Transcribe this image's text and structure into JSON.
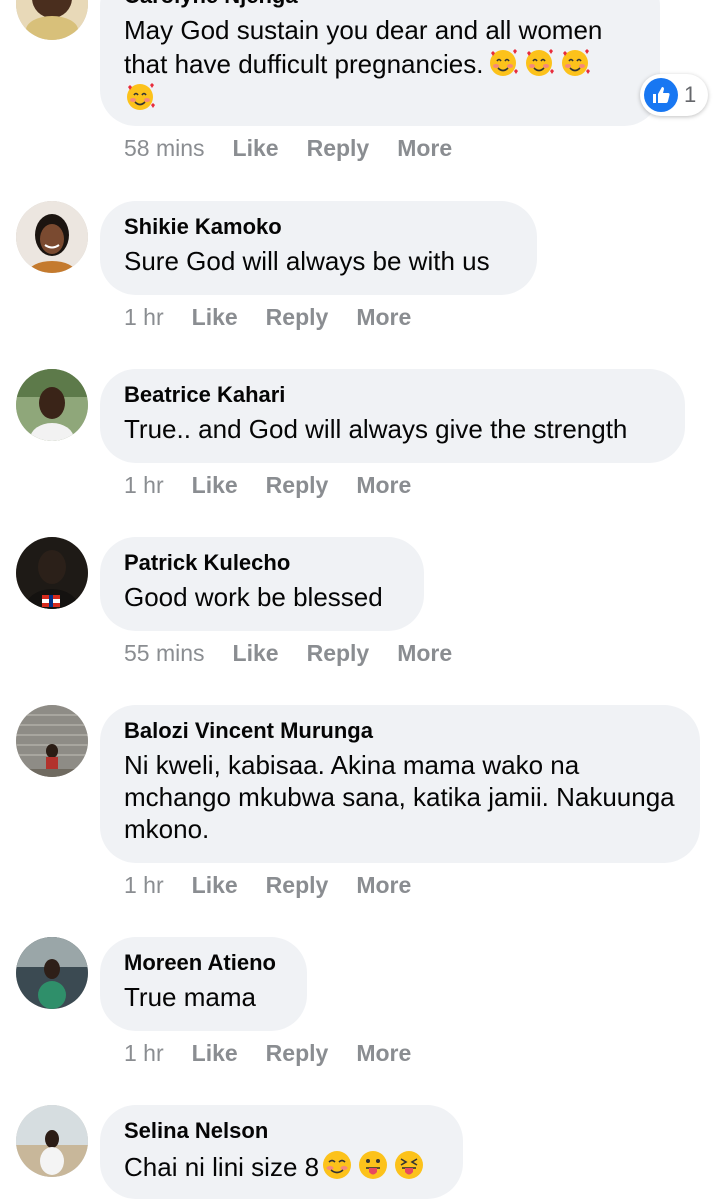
{
  "comments": [
    {
      "name": "Carolyne Njenga",
      "text": "May God sustain you dear and all women that have dufficult pregnancies.",
      "emojis": [
        "smiling-face-with-hearts",
        "smiling-face-with-hearts",
        "smiling-face-with-hearts",
        "smiling-face-with-hearts"
      ],
      "time": "58 mins",
      "reaction_count": "1",
      "reaction_icon": "thumbs-up-icon"
    },
    {
      "name": "Shikie Kamoko",
      "text": "Sure God will always be with us",
      "time": "1 hr"
    },
    {
      "name": "Beatrice Kahari",
      "text": "True.. and God will always give the strength",
      "time": "1 hr"
    },
    {
      "name": "Patrick Kulecho",
      "text": "Good work be blessed",
      "time": "55 mins"
    },
    {
      "name": "Balozi Vincent Murunga",
      "text": "Ni kweli, kabisaa. Akina mama wako na mchango mkubwa sana, katika jamii. Nakuunga mkono.",
      "time": "1 hr"
    },
    {
      "name": "Moreen Atieno",
      "text": "True mama",
      "time": "1 hr"
    },
    {
      "name": "Selina Nelson",
      "text": "Chai ni lini size 8",
      "emojis": [
        "smiling-face-blushing",
        "face-with-tongue",
        "squinting-face-with-tongue"
      ]
    }
  ],
  "actions": {
    "like": "Like",
    "reply": "Reply",
    "more": "More"
  },
  "colors": {
    "bubble": "#f0f2f5",
    "meta_text": "#8a8d91",
    "like_blue": "#1877f2",
    "name_text": "#050505"
  }
}
